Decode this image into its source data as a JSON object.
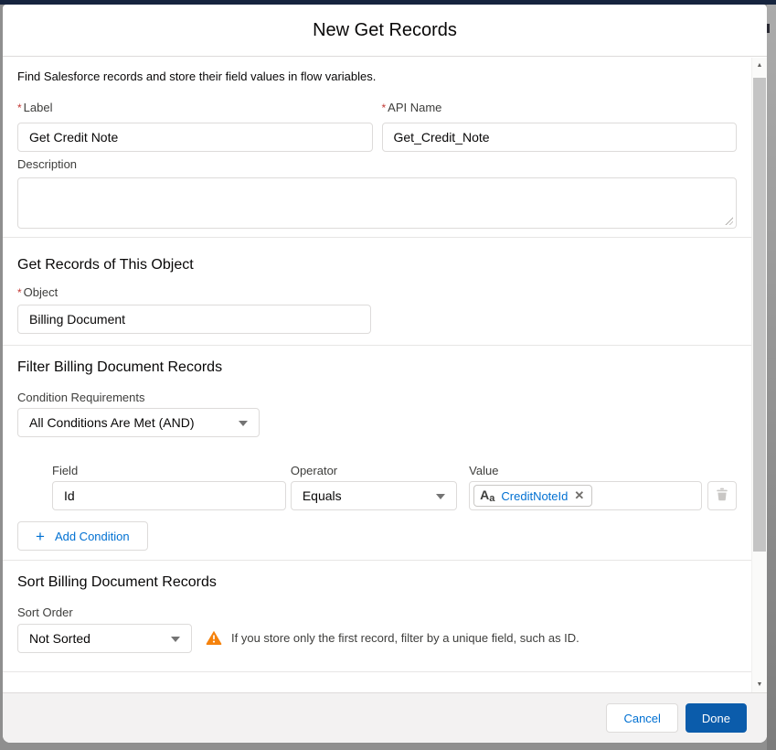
{
  "modal": {
    "title": "New Get Records",
    "intro": "Find Salesforce records and store their field values in flow variables."
  },
  "ui": {
    "required_marker": "*"
  },
  "form": {
    "label": {
      "label": "Label",
      "value": "Get Credit Note",
      "required": true
    },
    "api_name": {
      "label": "API Name",
      "value": "Get_Credit_Note",
      "required": true
    },
    "description": {
      "label": "Description",
      "value": ""
    }
  },
  "sections": {
    "object": {
      "heading": "Get Records of This Object",
      "field": {
        "label": "Object",
        "value": "Billing Document",
        "required": true
      }
    },
    "filter": {
      "heading": "Filter Billing Document Records",
      "condition_requirements": {
        "label": "Condition Requirements",
        "value": "All Conditions Are Met (AND)"
      },
      "condition": {
        "field": {
          "label": "Field",
          "value": "Id"
        },
        "operator": {
          "label": "Operator",
          "value": "Equals"
        },
        "value": {
          "label": "Value",
          "pill": "CreditNoteId"
        }
      },
      "add_condition_label": "Add Condition"
    },
    "sort": {
      "heading": "Sort Billing Document Records",
      "sort_order": {
        "label": "Sort Order",
        "value": "Not Sorted"
      },
      "warning": "If you store only the first record, filter by a unique field, such as ID."
    }
  },
  "footer": {
    "cancel_label": "Cancel",
    "done_label": "Done"
  },
  "icons": {
    "plus": "+",
    "close": "✕",
    "text_type_large": "A",
    "text_type_small": "a",
    "scroll_up": "▲",
    "scroll_down": "▼"
  },
  "colors": {
    "accent_blue": "#0070d2",
    "brand_button": "#0b5cab",
    "warning_orange": "#f5820c",
    "required_red": "#c23934",
    "header_navy": "#16243e"
  }
}
